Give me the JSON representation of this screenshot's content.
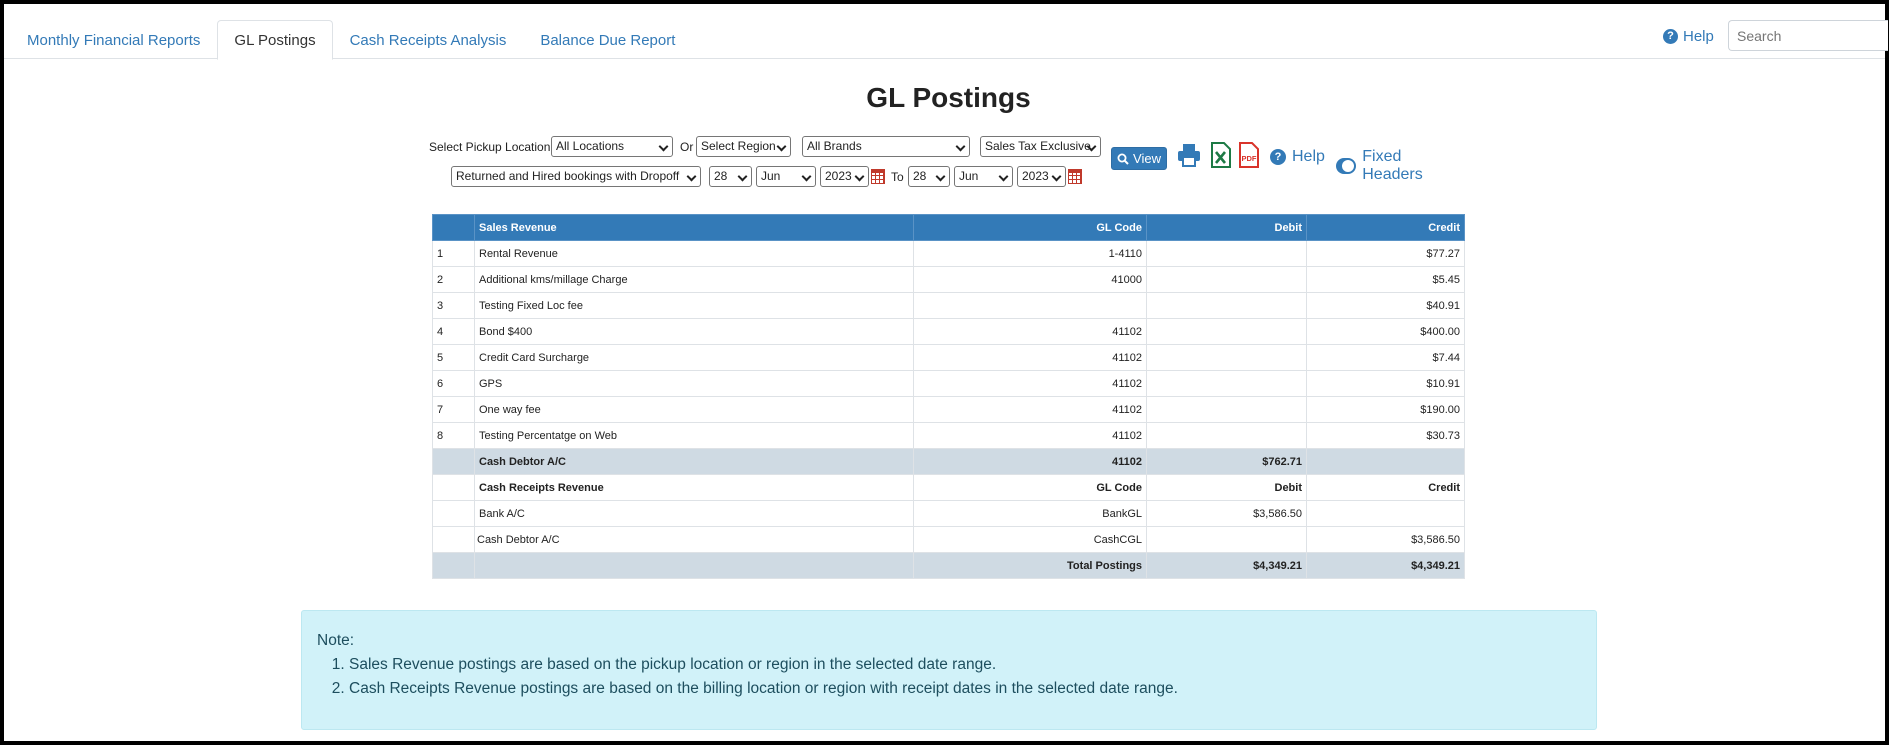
{
  "tabs": [
    {
      "label": "Monthly Financial Reports",
      "active": false
    },
    {
      "label": "GL Postings",
      "active": true
    },
    {
      "label": "Cash Receipts Analysis",
      "active": false
    },
    {
      "label": "Balance Due Report",
      "active": false
    }
  ],
  "header": {
    "help_label": "Help",
    "search_placeholder": "Search"
  },
  "page": {
    "title": "GL Postings"
  },
  "filters": {
    "pickup_label": "Select Pickup Location",
    "location": "All Locations",
    "or_label": "Or",
    "region": "Select Region",
    "brand": "All Brands",
    "tax": "Sales Tax Exclusive",
    "booking_type": "Returned and Hired bookings with Dropoff",
    "from_day": "28",
    "from_month": "Jun",
    "from_year": "2023",
    "to_label": "To",
    "to_day": "28",
    "to_month": "Jun",
    "to_year": "2023",
    "view_label": "View",
    "help_label": "Help",
    "fixed_headers_label": "Fixed Headers"
  },
  "table": {
    "header": {
      "num": "",
      "name": "Sales Revenue",
      "gl": "GL Code",
      "debit": "Debit",
      "credit": "Credit"
    },
    "rows": [
      {
        "num": "1",
        "name": "Rental Revenue",
        "gl": "1-4110",
        "debit": "",
        "credit": "$77.27"
      },
      {
        "num": "2",
        "name": "Additional kms/millage Charge",
        "gl": "41000",
        "debit": "",
        "credit": "$5.45"
      },
      {
        "num": "3",
        "name": "Testing Fixed Loc fee",
        "gl": "",
        "debit": "",
        "credit": "$40.91"
      },
      {
        "num": "4",
        "name": "Bond $400",
        "gl": "41102",
        "debit": "",
        "credit": "$400.00"
      },
      {
        "num": "5",
        "name": "Credit Card Surcharge",
        "gl": "41102",
        "debit": "",
        "credit": "$7.44"
      },
      {
        "num": "6",
        "name": "GPS",
        "gl": "41102",
        "debit": "",
        "credit": "$10.91"
      },
      {
        "num": "7",
        "name": "One way fee",
        "gl": "41102",
        "debit": "",
        "credit": "$190.00"
      },
      {
        "num": "8",
        "name": "Testing Percentatge on Web",
        "gl": "41102",
        "debit": "",
        "credit": "$30.73"
      }
    ],
    "cash_debtor": {
      "name": "Cash Debtor A/C",
      "gl": "41102",
      "debit": "$762.71",
      "credit": ""
    },
    "receipts_header": {
      "name": "Cash Receipts Revenue",
      "gl": "GL Code",
      "debit": "Debit",
      "credit": "Credit"
    },
    "receipt_rows": [
      {
        "name": "Bank A/C",
        "gl": "BankGL",
        "debit": "$3,586.50",
        "credit": ""
      },
      {
        "name": "Cash Debtor A/C",
        "gl": "CashCGL",
        "debit": "",
        "credit": "$3,586.50"
      }
    ],
    "totals": {
      "label": "Total Postings",
      "debit": "$4,349.21",
      "credit": "$4,349.21"
    }
  },
  "note": {
    "title": "Note:",
    "items": [
      "Sales Revenue postings are based on the pickup location or region in the selected date range.",
      "Cash Receipts Revenue postings are based on the billing location or region with receipt dates in the selected date range."
    ]
  },
  "colors": {
    "primary": "#337ab7",
    "subtotal_row": "#cfdae3",
    "note_bg": "#d1f2f9",
    "excel_green": "#1d7a45",
    "pdf_red": "#d9342b"
  }
}
